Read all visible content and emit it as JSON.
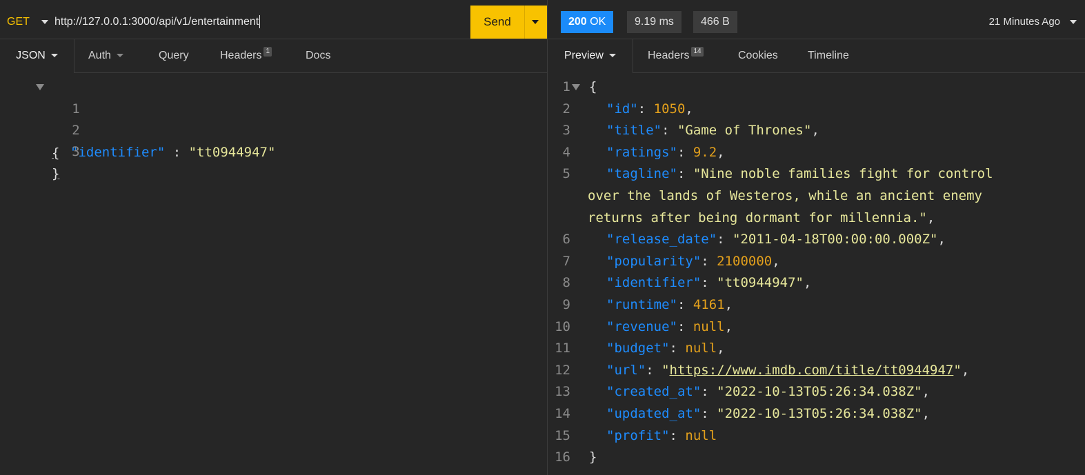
{
  "request": {
    "method": "GET",
    "url": "http://127.0.0.1:3000/api/v1/entertainment",
    "send_label": "Send",
    "tabs": [
      {
        "label": "JSON",
        "dropdown": true
      },
      {
        "label": "Auth",
        "dropdown": true
      },
      {
        "label": "Query"
      },
      {
        "label": "Headers",
        "count": "1"
      },
      {
        "label": "Docs"
      }
    ],
    "body_lines": [
      {
        "num": "1",
        "open": "{"
      },
      {
        "num": "2",
        "key": "\"identifier\"",
        "sep": " : ",
        "value": "\"tt0944947\""
      },
      {
        "num": "3",
        "close": "}"
      }
    ]
  },
  "response": {
    "status_code": "200",
    "status_text": "OK",
    "time": "9.19 ms",
    "size": "466 B",
    "timestamp": "21 Minutes Ago",
    "tabs": [
      {
        "label": "Preview",
        "dropdown": true
      },
      {
        "label": "Headers",
        "count": "14"
      },
      {
        "label": "Cookies"
      },
      {
        "label": "Timeline"
      }
    ],
    "line_numbers": [
      "1",
      "2",
      "3",
      "4",
      "5",
      "6",
      "7",
      "8",
      "9",
      "10",
      "11",
      "12",
      "13",
      "14",
      "15",
      "16"
    ],
    "open": "{",
    "close": "}",
    "fields": [
      {
        "key": "\"id\"",
        "value": "1050",
        "type": "number"
      },
      {
        "key": "\"title\"",
        "value": "\"Game of Thrones\"",
        "type": "string"
      },
      {
        "key": "\"ratings\"",
        "value": "9.2",
        "type": "number"
      },
      {
        "key": "\"tagline\"",
        "value_lines": [
          "\"Nine noble families fight for control",
          "over the lands of Westeros, while an ancient enemy",
          "returns after being dormant for millennia.\""
        ],
        "type": "string"
      },
      {
        "key": "\"release_date\"",
        "value": "\"2011-04-18T00:00:00.000Z\"",
        "type": "string"
      },
      {
        "key": "\"popularity\"",
        "value": "2100000",
        "type": "number"
      },
      {
        "key": "\"identifier\"",
        "value": "\"tt0944947\"",
        "type": "string"
      },
      {
        "key": "\"runtime\"",
        "value": "4161",
        "type": "number"
      },
      {
        "key": "\"revenue\"",
        "value": "null",
        "type": "null"
      },
      {
        "key": "\"budget\"",
        "value": "null",
        "type": "null"
      },
      {
        "key": "\"url\"",
        "value": "https://www.imdb.com/title/tt0944947",
        "type": "url"
      },
      {
        "key": "\"created_at\"",
        "value": "\"2022-10-13T05:26:34.038Z\"",
        "type": "string"
      },
      {
        "key": "\"updated_at\"",
        "value": "\"2022-10-13T05:26:34.038Z\"",
        "type": "string"
      },
      {
        "key": "\"profit\"",
        "value": "null",
        "type": "null"
      }
    ]
  },
  "colors": {
    "accent": "#f8c200",
    "status_ok": "#1b8bf9",
    "json_key": "#1e8cff",
    "json_string": "#e6e69a",
    "json_number": "#e3a01c"
  }
}
